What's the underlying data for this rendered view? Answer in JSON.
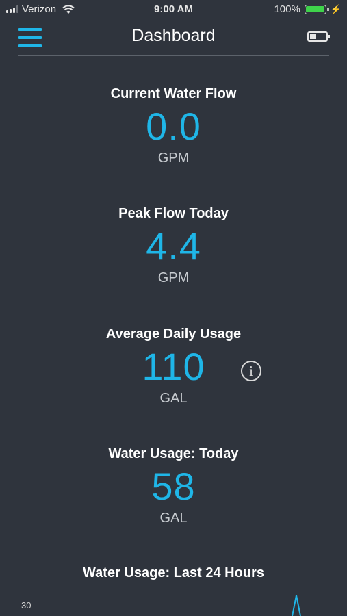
{
  "status_bar": {
    "carrier": "Verizon",
    "time": "9:00 AM",
    "battery_percent": "100%",
    "battery_color": "#3fd34b"
  },
  "header": {
    "title": "Dashboard",
    "menu_icon": "hamburger-menu-icon",
    "device_icon": "device-battery-icon"
  },
  "metrics": [
    {
      "label": "Current Water Flow",
      "value": "0.0",
      "unit": "GPM"
    },
    {
      "label": "Peak Flow Today",
      "value": "4.4",
      "unit": "GPM"
    },
    {
      "label": "Average Daily Usage",
      "value": "110",
      "unit": "GAL"
    },
    {
      "label": "Water Usage: Today",
      "value": "58",
      "unit": "GAL"
    }
  ],
  "chart": {
    "title": "Water Usage: Last 24 Hours",
    "y_tick": "30"
  },
  "accent_color": "#1fb6e8",
  "background_color": "#2f343d"
}
